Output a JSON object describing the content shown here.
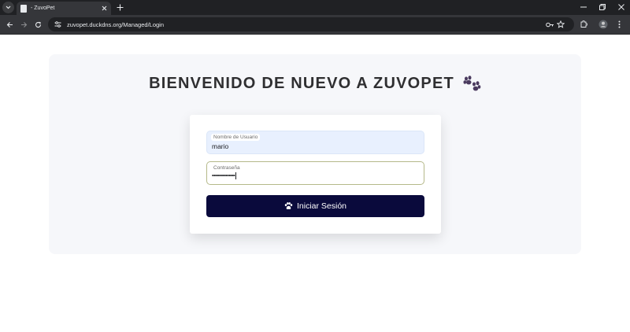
{
  "browser": {
    "tab_title": "- ZuvoPet",
    "url": "zuvopet.duckdns.org/Managed/Login",
    "icons": [
      "tab-list-icon",
      "page-favicon-icon",
      "close-icon",
      "plus-icon",
      "minimize-icon",
      "restore-icon",
      "close-window-icon",
      "back-icon",
      "forward-icon",
      "reload-icon",
      "site-info-icon",
      "password-key-icon",
      "star-icon",
      "extensions-icon",
      "profile-icon",
      "kebab-menu-icon"
    ]
  },
  "page": {
    "heading": "BIENVENIDO DE NUEVO A ZUVOPET",
    "heading_icon": "paw-icon",
    "username": {
      "label": "Nombre de Usuario",
      "value": "mario"
    },
    "password": {
      "label": "Contraseña",
      "masked_value": "•••••••••••••••"
    },
    "submit": {
      "icon": "paw-icon",
      "label": "Iniciar Sesión"
    }
  },
  "colors": {
    "button_bg": "#0a0a3c",
    "paw_title": "#4a3a5e",
    "panel_bg": "#f6f7fa",
    "username_bg": "#e8f0fe",
    "password_border": "#b5b98a"
  }
}
